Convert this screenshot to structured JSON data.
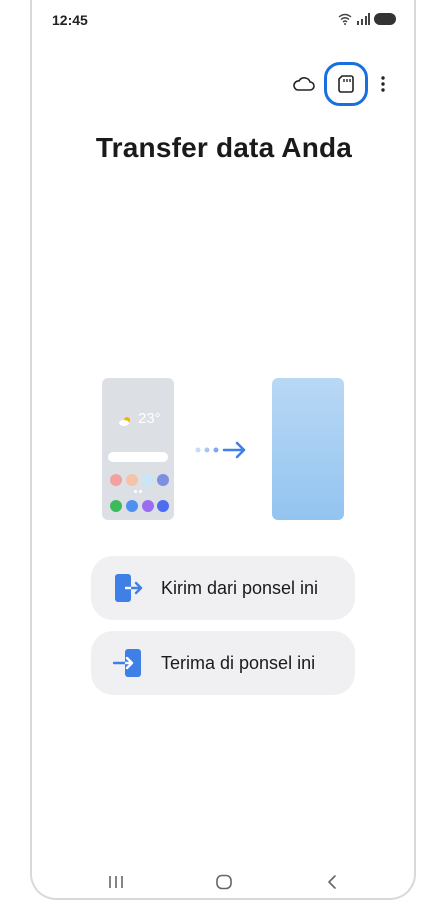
{
  "status": {
    "time": "12:45"
  },
  "header": {
    "title": "Transfer data Anda"
  },
  "illustration": {
    "temperature": "23°"
  },
  "actions": {
    "send_label": "Kirim dari ponsel ini",
    "receive_label": "Terima di ponsel ini"
  },
  "colors": {
    "accent": "#1a6fe0",
    "button_bg": "#f0f0f2",
    "icon_blue": "#3f7fe8"
  }
}
